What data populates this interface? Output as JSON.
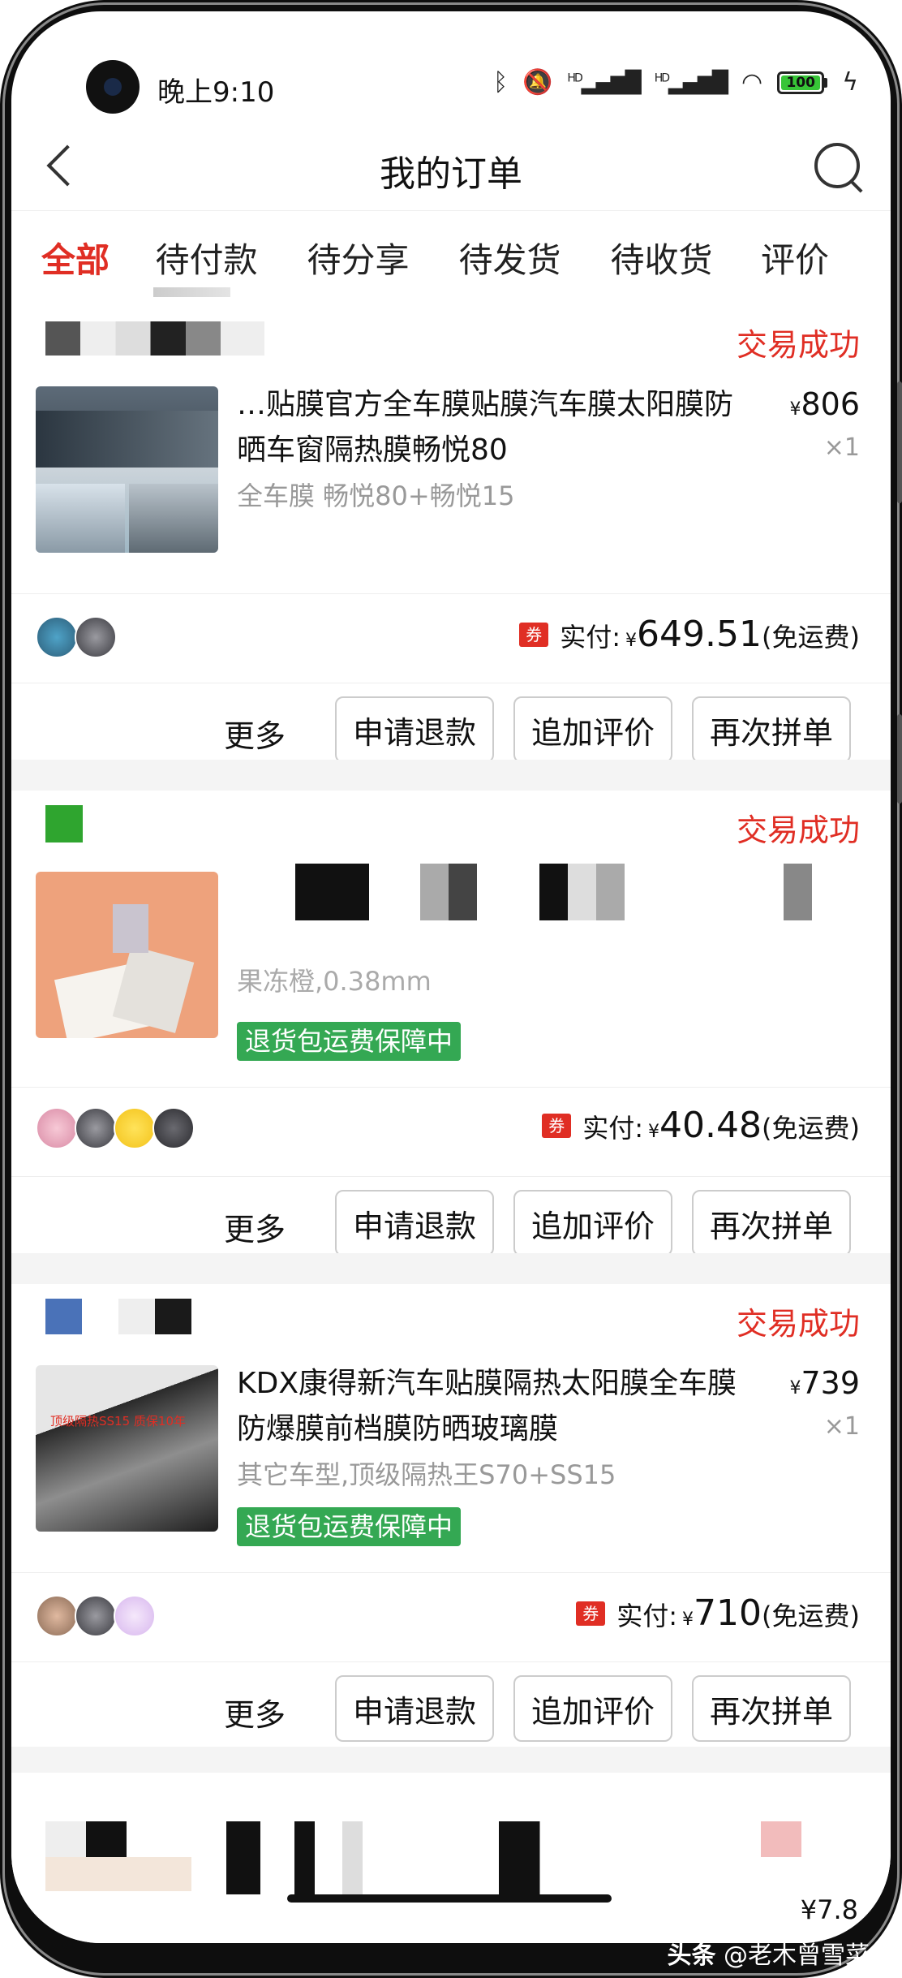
{
  "status_bar": {
    "time": "晚上9:10",
    "hd1": "HD",
    "hd2": "HD",
    "battery": "100"
  },
  "header": {
    "title": "我的订单"
  },
  "tabs": [
    {
      "label": "全部",
      "active": true
    },
    {
      "label": "待付款"
    },
    {
      "label": "待分享"
    },
    {
      "label": "待发货"
    },
    {
      "label": "待收货"
    },
    {
      "label": "评价"
    }
  ],
  "orders": [
    {
      "status": "交易成功",
      "title": "…贴膜官方全车膜贴膜汽车膜太阳膜防晒车窗隔热膜畅悦80",
      "sku": "全车膜 畅悦80+畅悦15",
      "price_symbol": "¥",
      "price": "806",
      "qty": "×1",
      "coupon": "券",
      "paid_label": "实付:",
      "paid_currency": "¥",
      "paid_amount": "649.51",
      "paid_note": "(免运费)",
      "actions": {
        "more": "更多",
        "refund": "申请退款",
        "review": "追加评价",
        "rebuy": "再次拼单"
      }
    },
    {
      "status": "交易成功",
      "sku": "果冻橙,0.38mm",
      "guarantee": "退货包运费保障中",
      "coupon": "券",
      "paid_label": "实付:",
      "paid_currency": "¥",
      "paid_amount": "40.48",
      "paid_note": "(免运费)",
      "actions": {
        "more": "更多",
        "refund": "申请退款",
        "review": "追加评价",
        "rebuy": "再次拼单"
      }
    },
    {
      "status": "交易成功",
      "title": "KDX康得新汽车贴膜隔热太阳膜全车膜防爆膜前档膜防晒玻璃膜",
      "sku": "其它车型,顶级隔热王S70+SS15",
      "guarantee": "退货包运费保障中",
      "image_caption": "顶级隔热SS15 质保10年",
      "price_symbol": "¥",
      "price": "739",
      "qty": "×1",
      "coupon": "券",
      "paid_label": "实付:",
      "paid_currency": "¥",
      "paid_amount": "710",
      "paid_note": "(免运费)",
      "actions": {
        "more": "更多",
        "refund": "申请退款",
        "review": "追加评价",
        "rebuy": "再次拼单"
      }
    }
  ],
  "partial_price": "¥7.8",
  "watermark": {
    "brand": "头条",
    "author": "@老木曾雪菜"
  },
  "colors": {
    "accent": "#e02e24",
    "guarantee": "#34a853",
    "gap": "#f4f4f4"
  }
}
